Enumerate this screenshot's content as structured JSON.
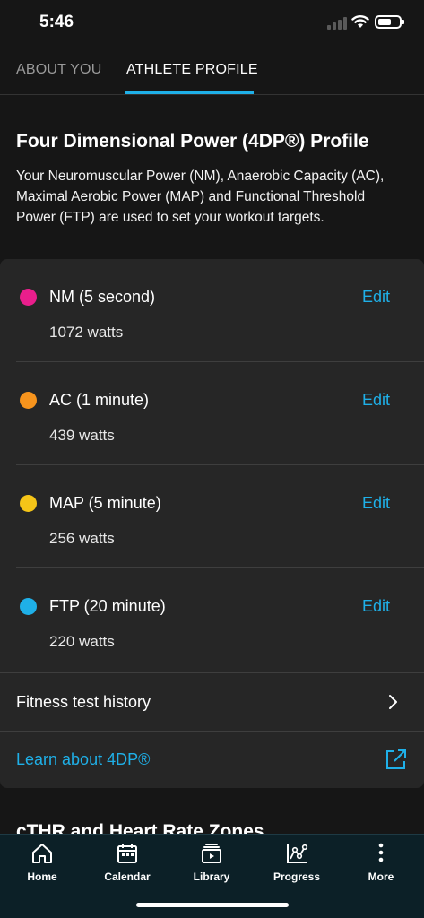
{
  "status_bar": {
    "time": "5:46"
  },
  "tabs": [
    {
      "label": "ABOUT YOU",
      "active": false
    },
    {
      "label": "ATHLETE PROFILE",
      "active": true
    }
  ],
  "profile": {
    "title": "Four Dimensional Power (4DP®) Profile",
    "description": "Your Neuromuscular Power (NM), Anaerobic Capacity (AC), Maximal Aerobic Power (MAP) and Functional Threshold Power (FTP) are used to set your workout targets."
  },
  "power_rows": [
    {
      "label": "NM (5 second)",
      "value": "1072 watts",
      "edit": "Edit",
      "color": "#e91e8c"
    },
    {
      "label": "AC (1 minute)",
      "value": "439 watts",
      "edit": "Edit",
      "color": "#f7941d"
    },
    {
      "label": "MAP (5 minute)",
      "value": "256 watts",
      "edit": "Edit",
      "color": "#f5c518"
    },
    {
      "label": "FTP (20 minute)",
      "value": "220 watts",
      "edit": "Edit",
      "color": "#1fb0e8"
    }
  ],
  "history": {
    "label": "Fitness test history",
    "icon": "chevron-right-icon"
  },
  "learn": {
    "label": "Learn about 4DP®",
    "icon": "external-link-icon"
  },
  "next_section": {
    "title": "cTHR and Heart Rate Zones"
  },
  "bottom_nav": [
    {
      "label": "Home",
      "icon": "home-icon"
    },
    {
      "label": "Calendar",
      "icon": "calendar-icon"
    },
    {
      "label": "Library",
      "icon": "library-icon"
    },
    {
      "label": "Progress",
      "icon": "progress-chart-icon"
    },
    {
      "label": "More",
      "icon": "more-vertical-icon"
    }
  ],
  "colors": {
    "accent": "#1fb0e8",
    "background": "#161616",
    "card": "#262626",
    "nav_background": "#0c2027"
  }
}
